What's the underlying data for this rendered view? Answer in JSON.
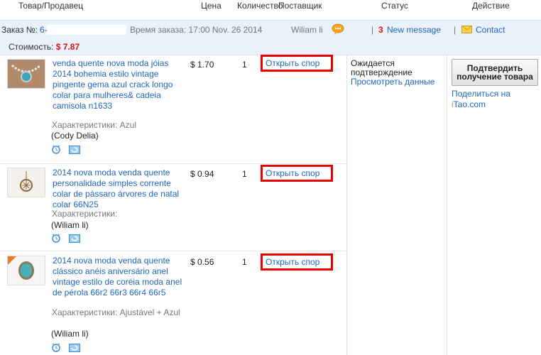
{
  "header": {
    "col_product": "Товар/Продавец",
    "col_price": "Цена",
    "col_qty": "Количество",
    "col_supplier": "Поставщик",
    "col_status": "Статус",
    "col_action": "Действие"
  },
  "order": {
    "number_label": "Заказ №:",
    "number_prefix": "6-",
    "time_label": "Время заказа: 17:00 Nov. 26 2014",
    "supplier_name": "Wiliam li",
    "message_count": "3",
    "message_label": "New message",
    "contact_label": "Contact",
    "cost_label": "Стоимость:",
    "cost_value": "$ 7.87"
  },
  "items": [
    {
      "title": "venda quente nova moda jóias 2014 bohemia estilo vintage pingente gema azul crack longo colar para mulheres& cadeia camisola n1633",
      "characteristics": "Характеристики: Azul",
      "seller": "(Cody Delia)",
      "price": "$ 1.70",
      "qty": "1",
      "dispute_label": "Открыть спор"
    },
    {
      "title": "2014 nova moda venda quente personalidade simples corrente colar de pássaro árvores de natal colar 66N25",
      "characteristics": "Характеристики:",
      "seller": "(Wiliam li)",
      "price": "$ 0.94",
      "qty": "1",
      "dispute_label": "Открыть спор"
    },
    {
      "title": "2014 nova moda venda quente clássico anéis aniversário anel vintage estilo de coréia moda anel de pérola 66r2 66r3 66r4 66r5",
      "characteristics": "Характеристики: Ajustável + Azul",
      "seller": "(Wiliam li)",
      "price": "$ 0.56",
      "qty": "1",
      "dispute_label": "Открыть спор"
    }
  ],
  "status": {
    "text": "Ожидается подтверждение",
    "view_link": "Просмотреть данные"
  },
  "action": {
    "confirm_label": "Подтвердить получение товара",
    "share_label": "Поделиться на",
    "share_site_i": "i",
    "share_site_rest": "Tao.com"
  },
  "colors": {
    "accent_blue": "#2266bb",
    "highlight_red": "#e00000",
    "order_bar_bg": "#e9f1fa"
  }
}
